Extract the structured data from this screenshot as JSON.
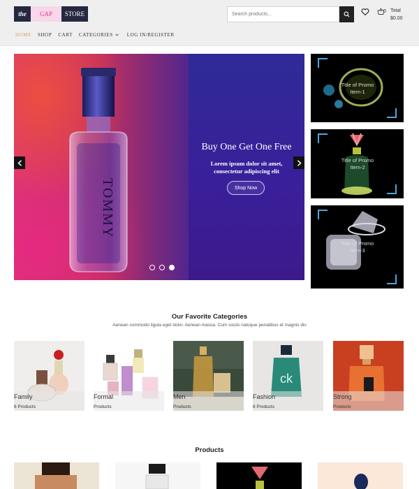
{
  "logo": {
    "part1": "the",
    "part2": "GAP",
    "part3": "STORE"
  },
  "search": {
    "placeholder": "Search products..."
  },
  "cart": {
    "count": "0",
    "total_label": "Total",
    "total_value": "$0.00"
  },
  "nav": {
    "home": "HOME",
    "shop": "SHOP",
    "cart": "CART",
    "categories": "CATEGORIES",
    "login": "LOG IN/REGISTER"
  },
  "hero": {
    "title": "Buy One Get One Free",
    "subtitle": "Lorem ipsum dolor sit amet, consectetur adipiscing elit",
    "button": "Shop Now",
    "bottle_text": "TOMMY",
    "active_slide": 3,
    "slide_count": 3
  },
  "promos": [
    {
      "line1": "Title of Promo",
      "line2": "Item-1"
    },
    {
      "line1": "Title of Promo",
      "line2": "Item-2"
    },
    {
      "line1": "Title of Promo",
      "line2": "Item-3"
    }
  ],
  "categories_section": {
    "title": "Our Favorite Categories",
    "subtitle": "Aenean commodo ligula eget dolor. Aenean massa. Cum sociis natoque penatibus et magnis dis",
    "items": [
      {
        "name": "Family",
        "count": "6 Products"
      },
      {
        "name": "Formal",
        "count": "Products"
      },
      {
        "name": "Men",
        "count": "Products"
      },
      {
        "name": "Fashion",
        "count": "6 Products"
      },
      {
        "name": "Strong",
        "count": "Products"
      }
    ]
  },
  "products_section": {
    "title": "Products"
  },
  "colors": {
    "nav_active": "#d9a365",
    "dark": "#25283f",
    "accent_blue": "#4ea7d8"
  }
}
